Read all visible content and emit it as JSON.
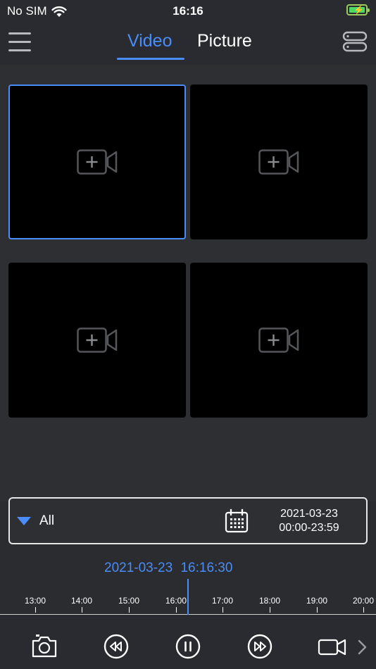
{
  "status_bar": {
    "carrier": "No SIM",
    "time": "16:16",
    "icons": [
      "wifi-icon",
      "battery-charging-icon"
    ]
  },
  "nav": {
    "tabs": [
      {
        "label": "Video",
        "active": true
      },
      {
        "label": "Picture",
        "active": false
      }
    ],
    "icons": [
      "menu-icon",
      "device-list-icon"
    ],
    "accent_color": "#4a8df8"
  },
  "grid": {
    "cells": [
      {
        "state": "empty",
        "selected": true,
        "icon": "add-camera-icon"
      },
      {
        "state": "empty",
        "selected": false,
        "icon": "add-camera-icon"
      },
      {
        "state": "empty",
        "selected": false,
        "icon": "add-camera-icon"
      },
      {
        "state": "empty",
        "selected": false,
        "icon": "add-camera-icon"
      }
    ]
  },
  "filter": {
    "type_label": "All",
    "date": "2021-03-23",
    "time_range": "00:00-23:59",
    "icons": [
      "dropdown-triangle-icon",
      "calendar-icon"
    ]
  },
  "timeline": {
    "current_date": "2021-03-23",
    "current_time": "16:16:30",
    "ticks": [
      "13:00",
      "14:00",
      "15:00",
      "16:00",
      "17:00",
      "18:00",
      "19:00",
      "20:00"
    ]
  },
  "toolbar": {
    "icons": [
      "snapshot-icon",
      "rewind-icon",
      "pause-icon",
      "fast-forward-icon",
      "record-icon",
      "chevron-right-icon"
    ]
  }
}
